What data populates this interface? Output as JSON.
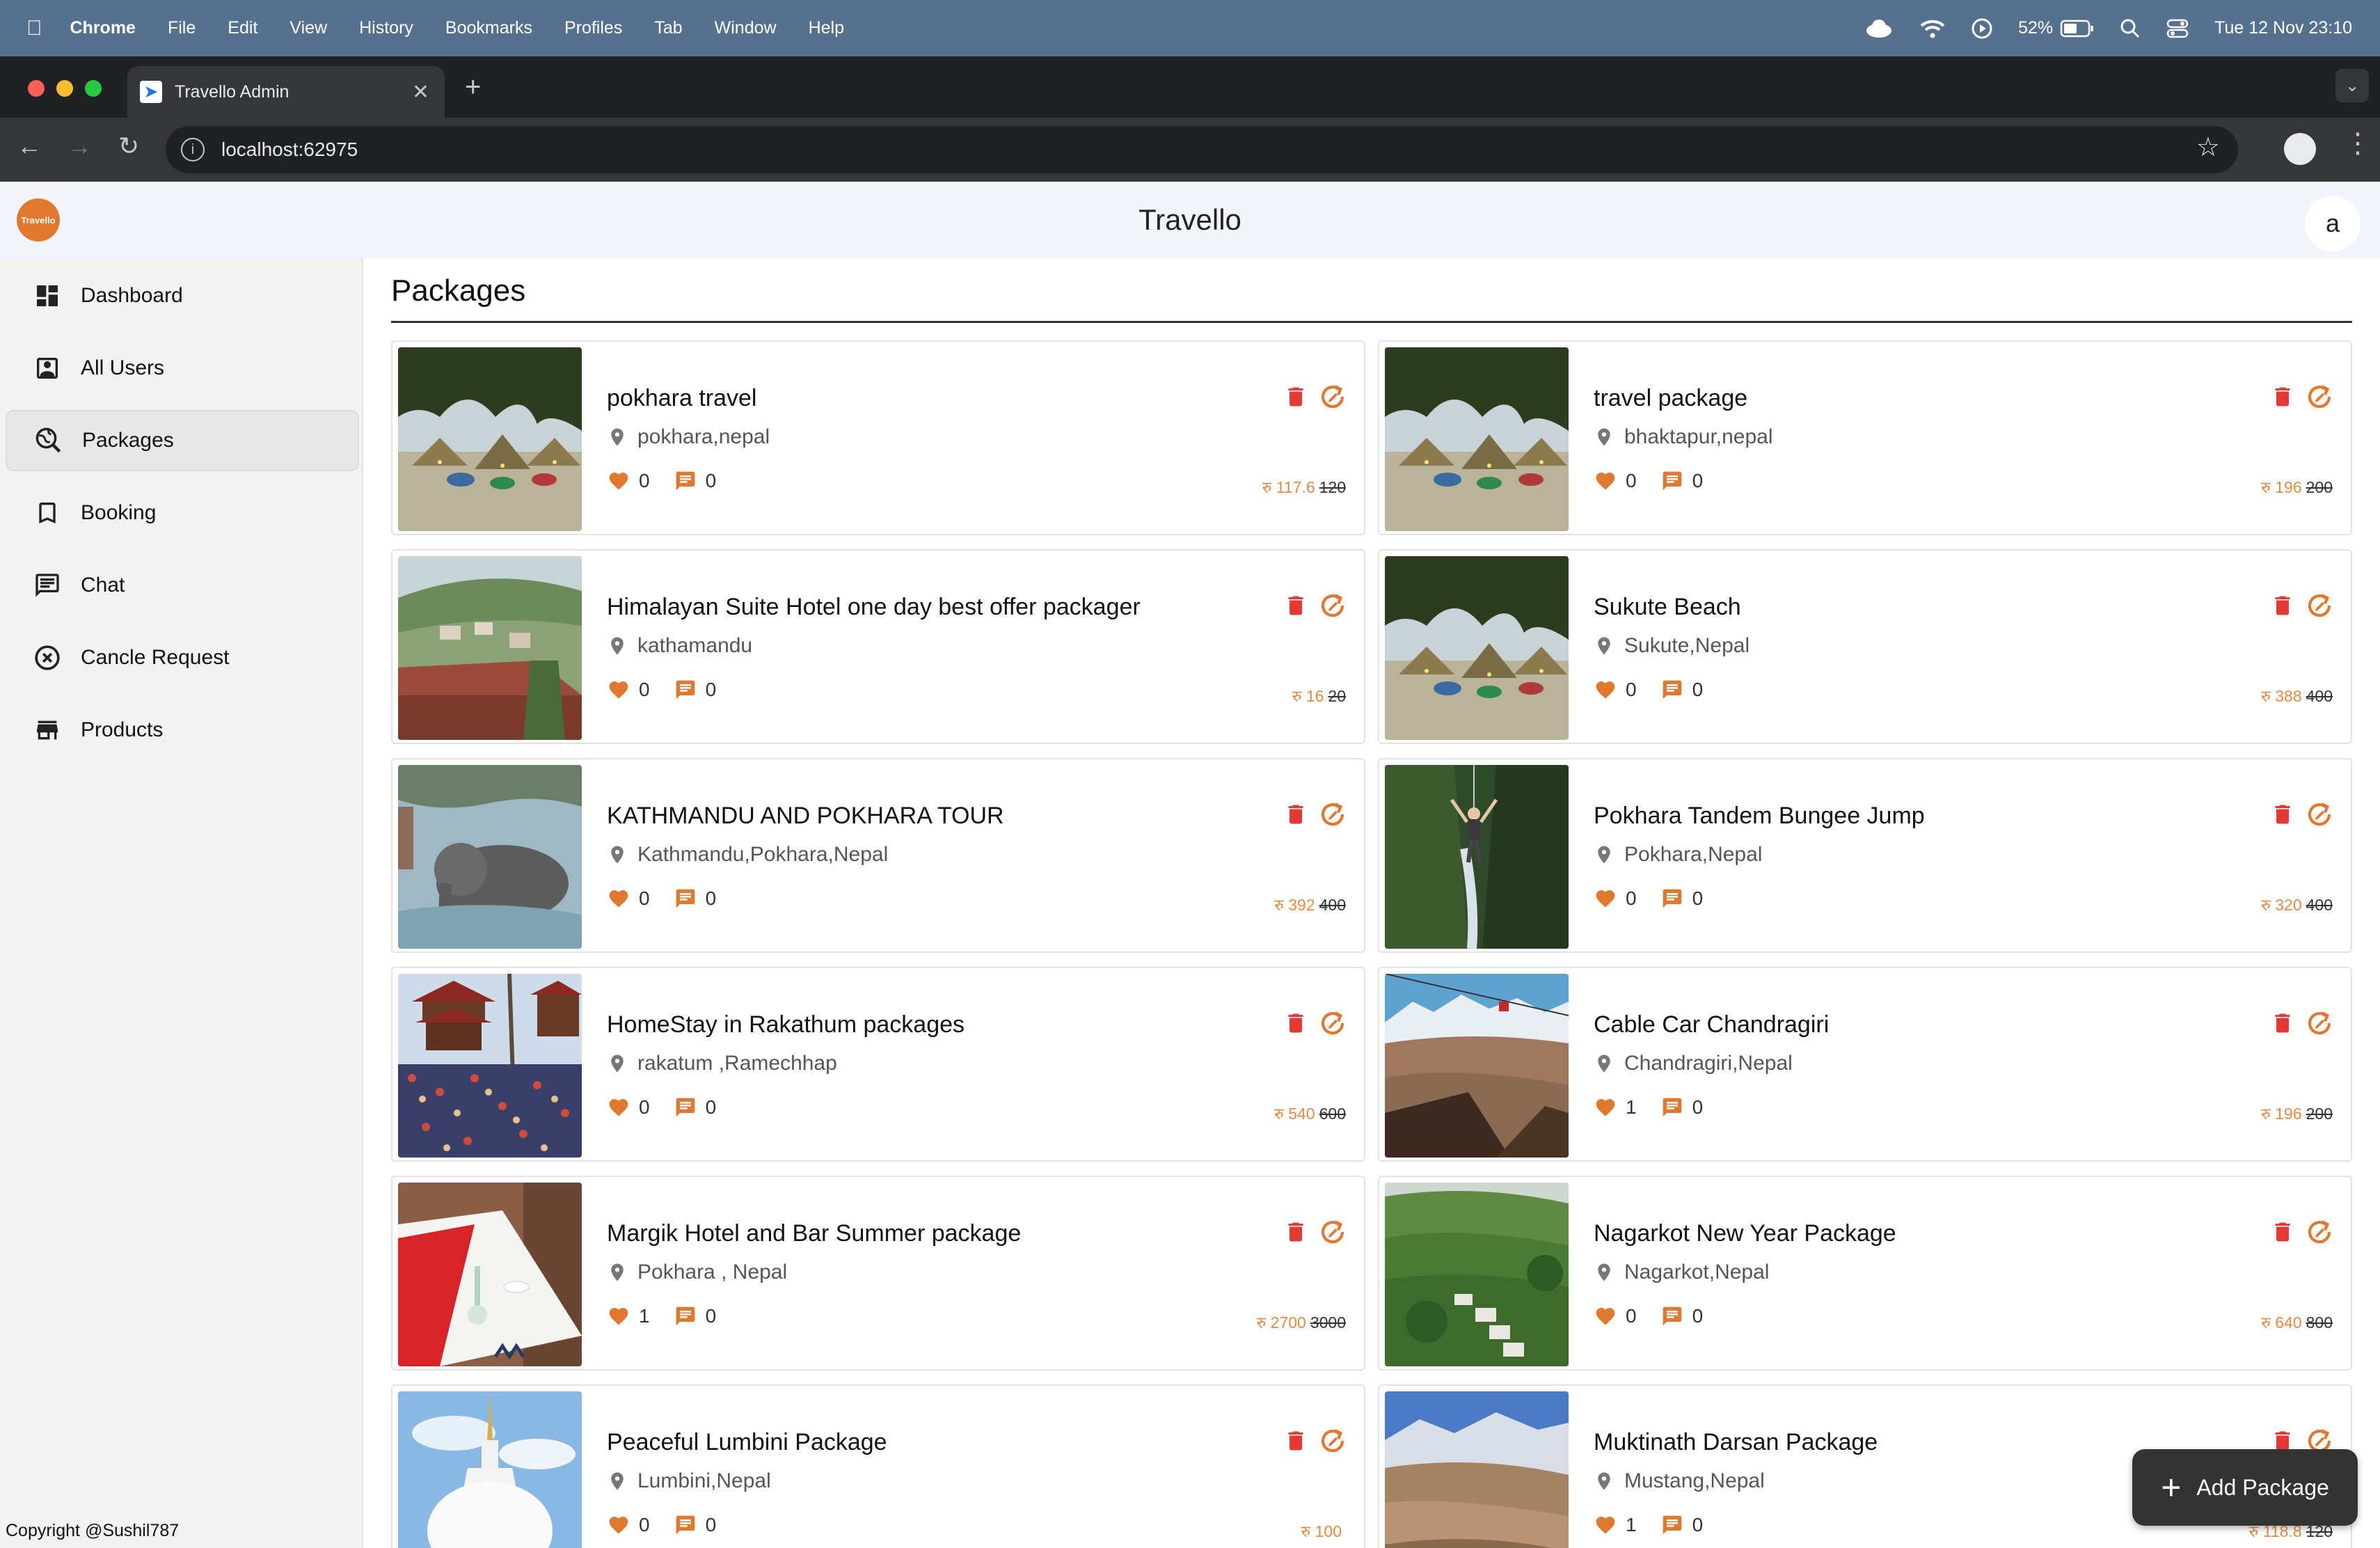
{
  "menubar": {
    "app": "Chrome",
    "items": [
      "File",
      "Edit",
      "View",
      "History",
      "Bookmarks",
      "Profiles",
      "Tab",
      "Window",
      "Help"
    ],
    "battery": "52%",
    "datetime": "Tue 12 Nov  23:10"
  },
  "browser": {
    "tab_title": "Travello Admin",
    "url": "localhost:62975"
  },
  "app": {
    "title": "Travello",
    "logo_text": "Travello",
    "avatar_letter": "a"
  },
  "sidebar": {
    "items": [
      {
        "label": "Dashboard",
        "icon": "dashboard-icon"
      },
      {
        "label": "All Users",
        "icon": "users-icon"
      },
      {
        "label": "Packages",
        "icon": "travel-explore-icon",
        "active": true
      },
      {
        "label": "Booking",
        "icon": "bookmark-icon"
      },
      {
        "label": "Chat",
        "icon": "chat-icon"
      },
      {
        "label": "Cancle Request",
        "icon": "cancel-icon"
      },
      {
        "label": "Products",
        "icon": "store-icon"
      }
    ],
    "copyright": "Copyright @Sushil787"
  },
  "main": {
    "title": "Packages",
    "add_button": "Add Package",
    "currency": "रु",
    "packages": [
      {
        "title": "pokhara travel",
        "location": "pokhara,nepal",
        "likes": "0",
        "comments": "0",
        "price": "117.6",
        "old_price": "120",
        "image": "night-tents"
      },
      {
        "title": "travel package",
        "location": "bhaktapur,nepal",
        "likes": "0",
        "comments": "0",
        "price": "196",
        "old_price": "200",
        "image": "night-tents"
      },
      {
        "title": "Himalayan Suite Hotel one day best offer packager",
        "location": "kathamandu",
        "likes": "0",
        "comments": "0",
        "price": "16",
        "old_price": "20",
        "image": "hillside-hotel"
      },
      {
        "title": "Sukute Beach",
        "location": "Sukute,Nepal",
        "likes": "0",
        "comments": "0",
        "price": "388",
        "old_price": "400",
        "image": "night-tents"
      },
      {
        "title": "KATHMANDU AND POKHARA TOUR",
        "location": "Kathmandu,Pokhara,Nepal",
        "likes": "0",
        "comments": "0",
        "price": "392",
        "old_price": "400",
        "image": "elephant-bath"
      },
      {
        "title": "Pokhara Tandem Bungee Jump",
        "location": "Pokhara,Nepal",
        "likes": "0",
        "comments": "0",
        "price": "320",
        "old_price": "400",
        "image": "bungee-gorge"
      },
      {
        "title": "HomeStay in Rakathum packages",
        "location": "rakatum ,Ramechhap",
        "likes": "0",
        "comments": "0",
        "price": "540",
        "old_price": "600",
        "image": "temple-crowd"
      },
      {
        "title": "Cable Car Chandragiri",
        "location": "Chandragiri,Nepal",
        "likes": "1",
        "comments": "0",
        "price": "196",
        "old_price": "200",
        "image": "mountain-valley"
      },
      {
        "title": "Margik Hotel and Bar Summer package",
        "location": "Pokhara , Nepal",
        "likes": "1",
        "comments": "0",
        "price": "2700",
        "old_price": "3000",
        "image": "dining-table"
      },
      {
        "title": "Nagarkot New Year Package",
        "location": "Nagarkot,Nepal",
        "likes": "0",
        "comments": "0",
        "price": "640",
        "old_price": "800",
        "image": "green-hills"
      },
      {
        "title": "Peaceful Lumbini Package",
        "location": "Lumbini,Nepal",
        "likes": "0",
        "comments": "0",
        "price": "100",
        "old_price": "",
        "image": "white-stupa"
      },
      {
        "title": "Muktinath Darsan Package",
        "location": "Mustang,Nepal",
        "likes": "1",
        "comments": "0",
        "price": "118.8",
        "old_price": "120",
        "image": "mustang-valley"
      }
    ]
  },
  "colors": {
    "accent": "#e07830",
    "delete": "#e53935",
    "menubar": "#56718f",
    "sidebar": "#f2f2f2"
  }
}
